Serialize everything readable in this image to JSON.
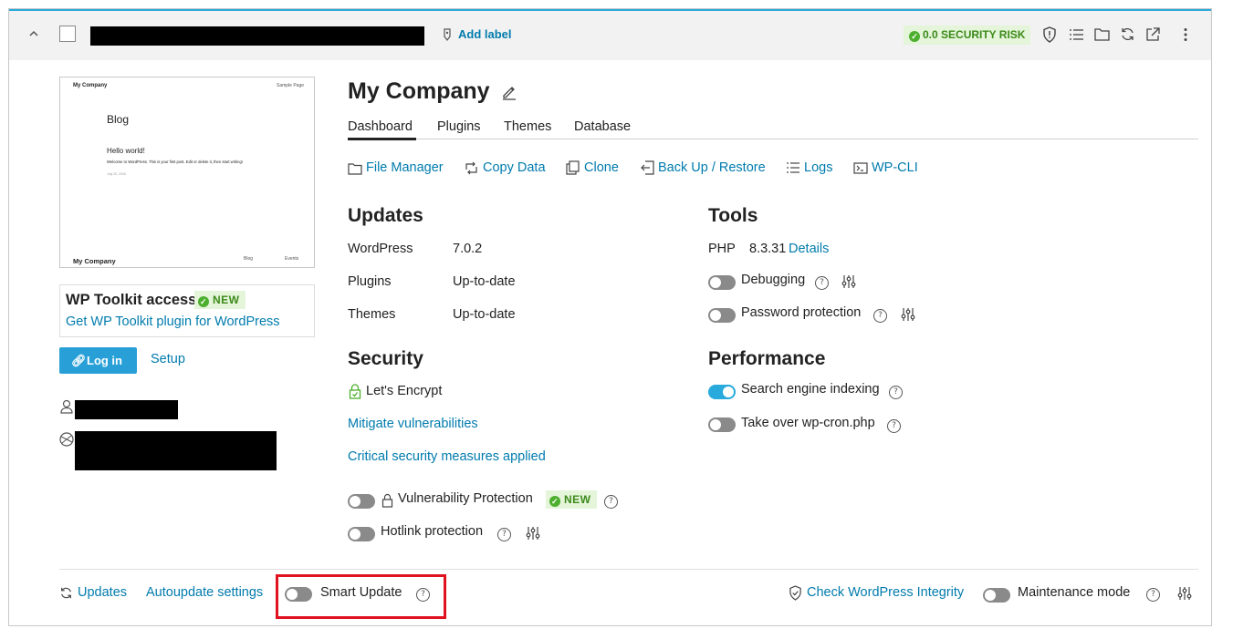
{
  "topbar": {
    "add_label": "Add label",
    "security_badge": "0.0 SECURITY RISK",
    "icons": [
      "shield-icon",
      "list-icon",
      "folder-icon",
      "refresh-icon",
      "open-external-icon",
      "more-vertical-icon"
    ]
  },
  "preview": {
    "site_name": "My Company",
    "sample_page": "Sample Page",
    "blog": "Blog",
    "post_title": "Hello world!",
    "post_text": "Welcome to WordPress. This is your first post. Edit or delete it, then start writing!",
    "post_date": "July 20, 2026",
    "footer_name": "My Company",
    "footer_blog": "Blog",
    "footer_events": "Events"
  },
  "toolkit": {
    "title": "WP Toolkit access",
    "new_badge": "NEW",
    "link": "Get WP Toolkit plugin for WordPress",
    "login": "Log in",
    "setup": "Setup"
  },
  "site": {
    "title": "My Company",
    "tabs": [
      "Dashboard",
      "Plugins",
      "Themes",
      "Database"
    ],
    "active_tab": "Dashboard"
  },
  "actions": {
    "file_manager": "File Manager",
    "copy_data": "Copy Data",
    "clone": "Clone",
    "backup": "Back Up / Restore",
    "logs": "Logs",
    "wpcli": "WP-CLI"
  },
  "updates": {
    "heading": "Updates",
    "rows": [
      {
        "label": "WordPress",
        "value": "7.0.2"
      },
      {
        "label": "Plugins",
        "value": "Up-to-date"
      },
      {
        "label": "Themes",
        "value": "Up-to-date"
      }
    ]
  },
  "security": {
    "heading": "Security",
    "ssl": "Let's Encrypt",
    "mitigate": "Mitigate vulnerabilities",
    "critical": "Critical security measures applied",
    "vuln_protection": "Vulnerability Protection",
    "vuln_new": "NEW",
    "hotlink": "Hotlink protection"
  },
  "tools": {
    "heading": "Tools",
    "php_label": "PHP",
    "php_version": "8.3.31",
    "php_details": "Details",
    "debugging": "Debugging",
    "password": "Password protection"
  },
  "performance": {
    "heading": "Performance",
    "indexing": "Search engine indexing",
    "indexing_on": true,
    "wpcron": "Take over wp-cron.php"
  },
  "footer": {
    "updates": "Updates",
    "autoupdate": "Autoupdate settings",
    "smart_update": "Smart Update",
    "integrity": "Check WordPress Integrity",
    "maintenance": "Maintenance mode"
  },
  "colors": {
    "accent": "#007bad",
    "toggle_on": "#28aadc",
    "highlight": "#e0121f",
    "badge_green": "#4caf2d"
  }
}
